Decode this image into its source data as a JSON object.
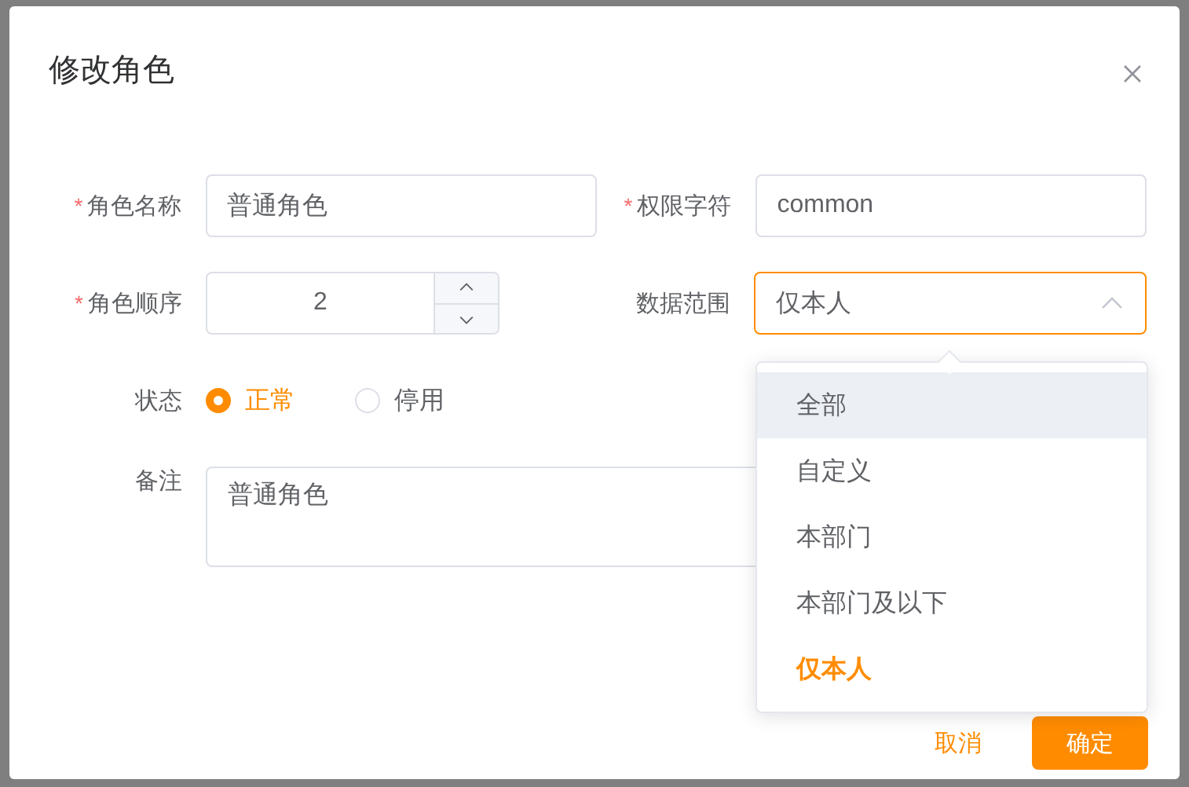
{
  "dialog": {
    "title": "修改角色",
    "fields": [
      {
        "kind": "text",
        "label": "角色名称",
        "required_mark": "*",
        "value": "普通角色"
      },
      {
        "kind": "text",
        "label": "权限字符",
        "required_mark": "*",
        "value": "common"
      },
      {
        "kind": "number",
        "label": "角色顺序",
        "required_mark": "*",
        "value": "2"
      },
      {
        "kind": "select",
        "label": "数据范围",
        "value": "仅本人",
        "expanded": true,
        "options": [
          {
            "label": "全部",
            "selected": false,
            "hovered": true
          },
          {
            "label": "自定义",
            "selected": false,
            "hovered": false
          },
          {
            "label": "本部门",
            "selected": false,
            "hovered": false
          },
          {
            "label": "本部门及以下",
            "selected": false,
            "hovered": false
          },
          {
            "label": "仅本人",
            "selected": true,
            "hovered": false
          }
        ]
      },
      {
        "kind": "radio",
        "label": "状态",
        "options": [
          {
            "label": "正常",
            "selected": true
          },
          {
            "label": "停用",
            "selected": false
          }
        ]
      },
      {
        "kind": "textarea",
        "label": "备注",
        "value": "普通角色"
      }
    ],
    "buttons": [
      {
        "label": "取消",
        "kind": "text"
      },
      {
        "label": "确定",
        "kind": "primary"
      }
    ]
  }
}
